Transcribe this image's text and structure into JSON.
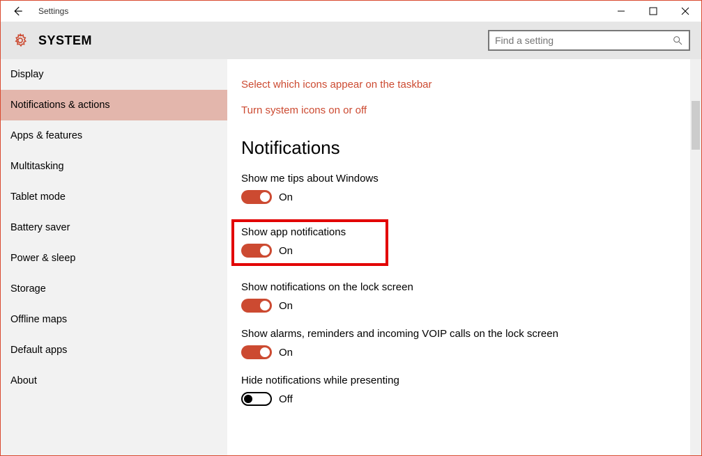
{
  "window": {
    "title": "Settings",
    "controls": {
      "min": "−",
      "max": "☐",
      "close": "✕"
    }
  },
  "header": {
    "title": "SYSTEM",
    "search_placeholder": "Find a setting"
  },
  "sidebar": {
    "items": [
      "Display",
      "Notifications & actions",
      "Apps & features",
      "Multitasking",
      "Tablet mode",
      "Battery saver",
      "Power & sleep",
      "Storage",
      "Offline maps",
      "Default apps",
      "About"
    ],
    "active_index": 1
  },
  "content": {
    "links": [
      "Select which icons appear on the taskbar",
      "Turn system icons on or off"
    ],
    "section_heading": "Notifications",
    "settings": [
      {
        "label": "Show me tips about Windows",
        "state": "On",
        "on": true,
        "highlight": false
      },
      {
        "label": "Show app notifications",
        "state": "On",
        "on": true,
        "highlight": true
      },
      {
        "label": "Show notifications on the lock screen",
        "state": "On",
        "on": true,
        "highlight": false
      },
      {
        "label": "Show alarms, reminders and incoming VOIP calls on the lock screen",
        "state": "On",
        "on": true,
        "highlight": false
      },
      {
        "label": "Hide notifications while presenting",
        "state": "Off",
        "on": false,
        "highlight": false
      }
    ]
  }
}
